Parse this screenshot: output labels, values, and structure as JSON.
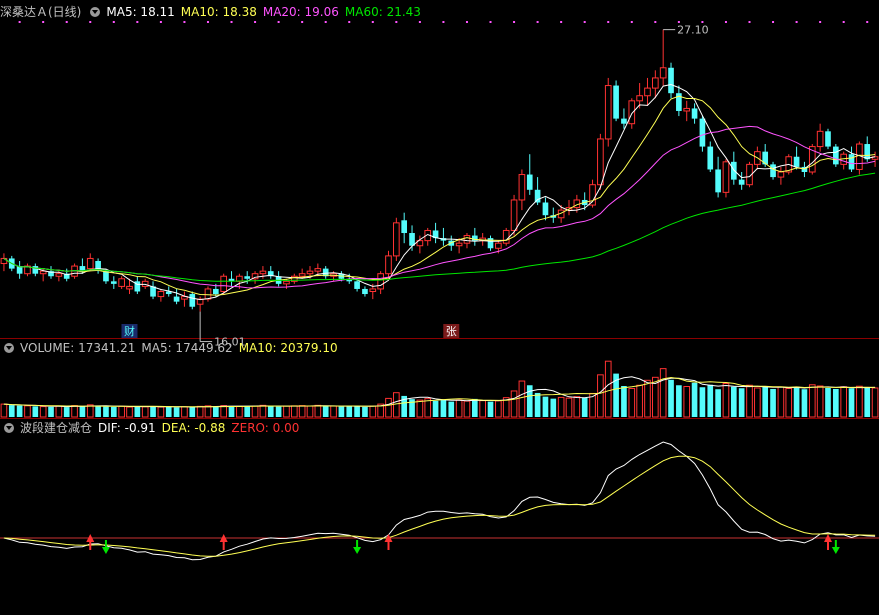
{
  "colors": {
    "up": "#ff3232",
    "down": "#54fcfc",
    "white": "#ffffff",
    "yellow": "#ffff54",
    "magenta": "#ff54ff",
    "green": "#00e600",
    "red_line": "#c83232",
    "grid": "#8b0000"
  },
  "price_panel": {
    "stock_name": "深桑达Ａ(日线)",
    "ma5": "MA5: 18.11",
    "ma10": "MA10: 18.38",
    "ma20": "MA20: 19.06",
    "ma60": "MA60: 21.43",
    "high_label": "27.10",
    "low_label": "16.01",
    "marker_cai": "财",
    "marker_zhang": "张"
  },
  "volume_panel": {
    "vol": "VOLUME: 17341.21",
    "ma5": "MA5: 17449.62",
    "ma10": "MA10: 20379.10"
  },
  "indicator_panel": {
    "name": "波段建仓减仓",
    "dif": "DIF: -0.91",
    "dea": "DEA: -0.88",
    "zero": "ZERO: 0.00"
  },
  "chart_data": [
    {
      "type": "candlestick",
      "title": "深桑达Ａ(日线)",
      "ylim": [
        15,
        28
      ],
      "ohlc": [
        [
          17.9,
          18.3,
          17.6,
          18.1
        ],
        [
          18.1,
          18.2,
          17.6,
          17.7
        ],
        [
          17.8,
          18.0,
          17.3,
          17.5
        ],
        [
          17.5,
          17.9,
          17.4,
          17.8
        ],
        [
          17.8,
          17.9,
          17.4,
          17.5
        ],
        [
          17.5,
          17.7,
          17.2,
          17.6
        ],
        [
          17.6,
          17.8,
          17.3,
          17.4
        ],
        [
          17.4,
          17.6,
          17.2,
          17.5
        ],
        [
          17.5,
          17.7,
          17.2,
          17.3
        ],
        [
          17.4,
          17.9,
          17.3,
          17.8
        ],
        [
          17.8,
          18.1,
          17.5,
          17.6
        ],
        [
          17.7,
          18.3,
          17.6,
          18.1
        ],
        [
          18.0,
          18.1,
          17.5,
          17.7
        ],
        [
          17.6,
          17.7,
          17.1,
          17.2
        ],
        [
          17.2,
          17.4,
          16.9,
          17.1
        ],
        [
          17.0,
          17.4,
          16.9,
          17.3
        ],
        [
          16.9,
          17.3,
          16.7,
          17.0
        ],
        [
          17.2,
          17.4,
          16.7,
          16.8
        ],
        [
          17.0,
          17.3,
          16.9,
          17.2
        ],
        [
          17.0,
          17.2,
          16.5,
          16.6
        ],
        [
          16.6,
          16.9,
          16.4,
          16.8
        ],
        [
          16.8,
          17.0,
          16.6,
          16.7
        ],
        [
          16.6,
          16.9,
          16.3,
          16.4
        ],
        [
          16.5,
          16.8,
          16.2,
          16.6
        ],
        [
          16.7,
          16.8,
          16.1,
          16.2
        ],
        [
          16.3,
          16.6,
          16.01,
          16.5
        ],
        [
          16.5,
          17.0,
          16.4,
          16.9
        ],
        [
          16.9,
          17.1,
          16.6,
          16.7
        ],
        [
          16.8,
          17.5,
          16.7,
          17.4
        ],
        [
          17.3,
          17.6,
          17.0,
          17.2
        ],
        [
          17.2,
          17.5,
          16.9,
          17.4
        ],
        [
          17.4,
          17.6,
          17.1,
          17.3
        ],
        [
          17.3,
          17.6,
          17.1,
          17.5
        ],
        [
          17.5,
          17.8,
          17.3,
          17.6
        ],
        [
          17.6,
          17.8,
          17.3,
          17.4
        ],
        [
          17.4,
          17.6,
          17.0,
          17.1
        ],
        [
          17.1,
          17.3,
          16.9,
          17.2
        ],
        [
          17.2,
          17.5,
          17.1,
          17.4
        ],
        [
          17.4,
          17.7,
          17.3,
          17.5
        ],
        [
          17.5,
          17.8,
          17.3,
          17.6
        ],
        [
          17.6,
          17.9,
          17.4,
          17.7
        ],
        [
          17.7,
          17.8,
          17.3,
          17.4
        ],
        [
          17.4,
          17.6,
          17.2,
          17.5
        ],
        [
          17.5,
          17.6,
          17.2,
          17.3
        ],
        [
          17.3,
          17.5,
          17.1,
          17.2
        ],
        [
          17.2,
          17.3,
          16.8,
          16.9
        ],
        [
          16.9,
          17.0,
          16.6,
          16.7
        ],
        [
          16.8,
          17.1,
          16.5,
          16.9
        ],
        [
          16.9,
          17.6,
          16.7,
          17.5
        ],
        [
          17.5,
          18.4,
          17.3,
          18.2
        ],
        [
          18.2,
          19.7,
          18.0,
          19.5
        ],
        [
          19.6,
          19.9,
          18.7,
          19.1
        ],
        [
          19.1,
          19.4,
          18.4,
          18.6
        ],
        [
          18.6,
          19.0,
          18.3,
          18.8
        ],
        [
          18.8,
          19.3,
          18.6,
          19.2
        ],
        [
          19.2,
          19.5,
          18.7,
          18.9
        ],
        [
          18.9,
          19.3,
          18.6,
          18.8
        ],
        [
          18.8,
          19.0,
          18.4,
          18.6
        ],
        [
          18.6,
          18.9,
          18.3,
          18.7
        ],
        [
          18.7,
          19.1,
          18.5,
          19.0
        ],
        [
          19.0,
          19.3,
          18.6,
          18.8
        ],
        [
          18.8,
          19.1,
          18.6,
          18.9
        ],
        [
          18.9,
          19.0,
          18.4,
          18.5
        ],
        [
          18.5,
          18.8,
          18.3,
          18.7
        ],
        [
          18.7,
          19.3,
          18.6,
          19.2
        ],
        [
          19.2,
          20.6,
          19.0,
          20.4
        ],
        [
          20.4,
          21.6,
          20.0,
          21.4
        ],
        [
          21.4,
          22.2,
          20.6,
          20.8
        ],
        [
          20.8,
          21.3,
          20.2,
          20.3
        ],
        [
          20.3,
          20.5,
          19.6,
          19.8
        ],
        [
          19.8,
          20.1,
          19.5,
          19.7
        ],
        [
          19.7,
          20.2,
          19.5,
          20.0
        ],
        [
          20.0,
          20.4,
          19.8,
          20.1
        ],
        [
          20.1,
          20.6,
          19.9,
          20.4
        ],
        [
          20.4,
          20.7,
          20.0,
          20.2
        ],
        [
          20.2,
          21.2,
          20.1,
          21.0
        ],
        [
          21.0,
          23.0,
          20.8,
          22.8
        ],
        [
          22.8,
          25.2,
          22.5,
          24.9
        ],
        [
          24.9,
          25.1,
          23.5,
          23.6
        ],
        [
          23.6,
          24.0,
          23.2,
          23.4
        ],
        [
          23.4,
          24.4,
          23.2,
          24.3
        ],
        [
          24.3,
          25.0,
          24.0,
          24.5
        ],
        [
          24.5,
          25.2,
          24.1,
          24.8
        ],
        [
          24.8,
          25.5,
          24.4,
          25.2
        ],
        [
          25.2,
          27.1,
          24.9,
          25.6
        ],
        [
          25.6,
          25.8,
          24.4,
          24.6
        ],
        [
          24.6,
          24.9,
          23.7,
          23.9
        ],
        [
          23.9,
          24.3,
          23.5,
          24.0
        ],
        [
          24.0,
          24.2,
          23.4,
          23.6
        ],
        [
          23.6,
          23.7,
          22.3,
          22.5
        ],
        [
          22.5,
          22.7,
          21.5,
          21.6
        ],
        [
          21.6,
          22.1,
          20.5,
          20.7
        ],
        [
          20.7,
          22.0,
          20.5,
          21.9
        ],
        [
          21.9,
          22.3,
          21.0,
          21.2
        ],
        [
          21.2,
          21.5,
          20.8,
          21.0
        ],
        [
          21.0,
          21.9,
          20.9,
          21.8
        ],
        [
          21.8,
          22.5,
          21.6,
          22.3
        ],
        [
          22.3,
          22.6,
          21.7,
          21.8
        ],
        [
          21.8,
          21.9,
          21.2,
          21.3
        ],
        [
          21.3,
          21.7,
          21.0,
          21.5
        ],
        [
          21.5,
          22.2,
          21.4,
          22.1
        ],
        [
          22.1,
          22.5,
          21.6,
          21.7
        ],
        [
          21.7,
          21.9,
          21.3,
          21.5
        ],
        [
          21.5,
          22.6,
          21.4,
          22.5
        ],
        [
          22.5,
          23.4,
          22.3,
          23.1
        ],
        [
          23.1,
          23.2,
          22.4,
          22.5
        ],
        [
          22.5,
          22.6,
          21.7,
          21.8
        ],
        [
          21.8,
          22.3,
          21.6,
          22.2
        ],
        [
          22.2,
          22.5,
          21.5,
          21.6
        ],
        [
          21.6,
          22.7,
          21.4,
          22.6
        ],
        [
          22.6,
          22.9,
          21.9,
          22.0
        ],
        [
          22.0,
          22.3,
          21.7,
          22.1
        ]
      ],
      "volume": [
        5200,
        4800,
        4600,
        4500,
        4300,
        4200,
        4100,
        4400,
        4000,
        4600,
        4300,
        4900,
        4500,
        4200,
        4100,
        4300,
        4000,
        4400,
        4100,
        4300,
        4000,
        4200,
        3900,
        4100,
        4000,
        4300,
        4500,
        4200,
        4600,
        4400,
        4300,
        4500,
        4400,
        4700,
        4300,
        4200,
        4400,
        4500,
        4600,
        4400,
        4700,
        4300,
        4400,
        4200,
        4500,
        4300,
        4100,
        4400,
        5200,
        7500,
        9800,
        8500,
        7200,
        6800,
        7400,
        6500,
        7000,
        6200,
        6800,
        6400,
        7300,
        6600,
        6200,
        6500,
        7800,
        10500,
        14500,
        12800,
        9700,
        8200,
        7400,
        7900,
        7600,
        8200,
        7700,
        9500,
        17000,
        22500,
        17500,
        12500,
        11500,
        12800,
        14800,
        16000,
        19500,
        15000,
        12800,
        12300,
        13800,
        12000,
        13000,
        11200,
        13500,
        12200,
        11600,
        12800,
        11700,
        12400,
        11300,
        12100,
        11500,
        12300,
        11200,
        13000,
        12500,
        11700,
        11300,
        12200,
        11600,
        12400,
        11800,
        11700
      ],
      "vol_ylim": [
        0,
        25000
      ],
      "price_ylim_note": "",
      "ma5": "18.11",
      "ma10": "18.38",
      "ma20": "19.06",
      "ma60": "21.43",
      "annotations": [
        {
          "x": 84,
          "text": "27.10"
        },
        {
          "x": 25,
          "text": "16.01"
        }
      ]
    },
    {
      "type": "line",
      "title": "波段建仓减仓",
      "series": [
        {
          "name": "DIF",
          "values": []
        },
        {
          "name": "DEA",
          "values": []
        }
      ],
      "zero": 0.0,
      "last_dif": -0.91,
      "last_dea": -0.88
    }
  ]
}
